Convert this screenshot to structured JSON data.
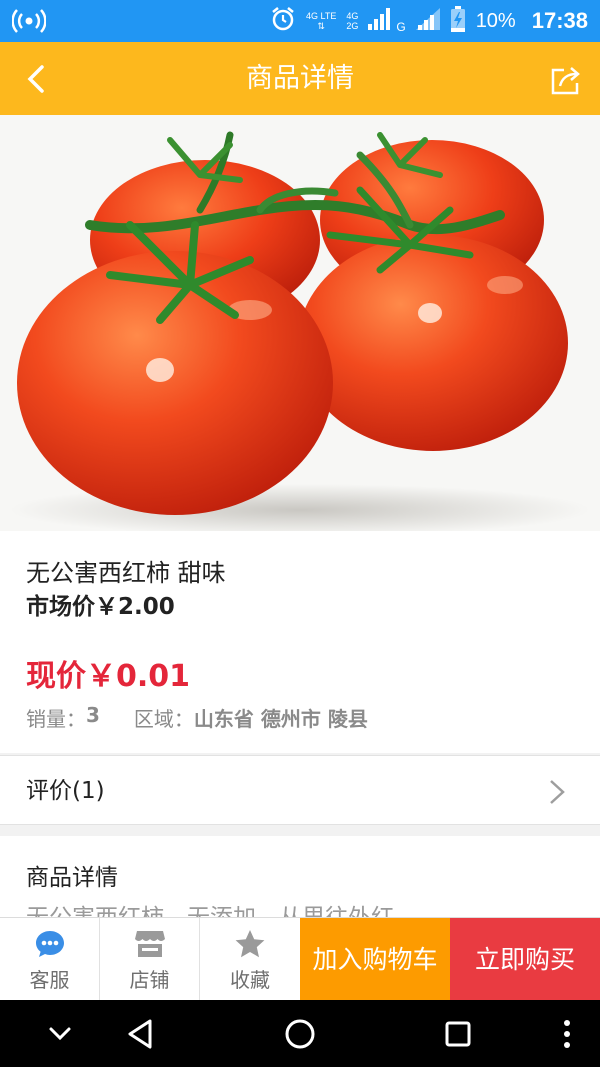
{
  "status_bar": {
    "network_tags": [
      "4G",
      "LTE",
      "4G",
      "2G"
    ],
    "carrier_g": "G",
    "battery": "10%",
    "time": "17:38"
  },
  "header": {
    "title": "商品详情",
    "back_icon": "chevron-left-icon",
    "share_icon": "share-icon"
  },
  "product": {
    "image_icon": "tomato-photo",
    "carousel_dots": 1,
    "name": "无公害西红柿 甜味",
    "market_price": "市场价￥2.00",
    "current_price": "现价￥0.01",
    "sales_label": "销量：",
    "sales_value": "3",
    "region_label": "区域：",
    "region_value": "山东省 德州市 陵县"
  },
  "reviews": {
    "label": "评价(1)"
  },
  "details": {
    "heading": "商品详情",
    "description": "无公害西红柿，无添加，从里往外红"
  },
  "action_bar": {
    "service": "客服",
    "store": "店铺",
    "favorite": "收藏",
    "add_to_cart": "加入购物车",
    "buy_now": "立即购买"
  },
  "colors": {
    "status_bar": "#2196f3",
    "header": "#fdb81d",
    "price_red": "#e4263a",
    "cart_orange": "#fd9b00",
    "buy_red": "#e93b41",
    "service_blue": "#3a8ee6"
  }
}
